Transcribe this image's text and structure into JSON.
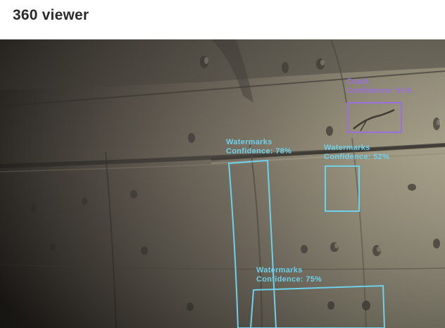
{
  "header": {
    "title": "360 viewer"
  },
  "viewer": {
    "detections": [
      {
        "label": "Crack",
        "confidence_text": "Confidence: 51%",
        "color": "#9b6fe0"
      },
      {
        "label": "Watermarks",
        "confidence_text": "Confidence: 78%",
        "color": "#6fd0ea"
      },
      {
        "label": "Watermarks",
        "confidence_text": "Confidence: 52%",
        "color": "#6fd0ea"
      },
      {
        "label": "Watermarks",
        "confidence_text": "Confidence: 75%",
        "color": "#6fd0ea"
      }
    ]
  }
}
